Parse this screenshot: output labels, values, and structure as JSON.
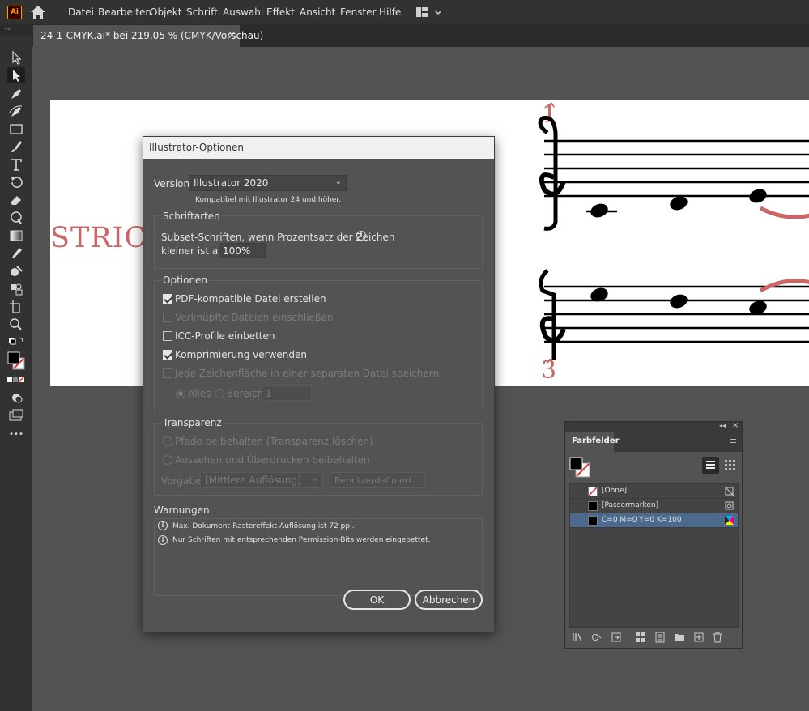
{
  "app": {
    "logo": "Ai"
  },
  "menu": [
    "Datei",
    "Bearbeiten",
    "Objekt",
    "Schrift",
    "Auswahl",
    "Effekt",
    "Ansicht",
    "Fenster",
    "Hilfe"
  ],
  "document_tab": {
    "title": "24-1-CMYK.ai* bei 219,05 % (CMYK/Vorschau)",
    "close": "×"
  },
  "toolbar": {
    "collapse": "››",
    "more": "•••",
    "tools": [
      "selection-tool",
      "direct-selection-tool",
      "pen-tool",
      "curvature-tool",
      "rectangle-tool",
      "paintbrush-tool",
      "type-tool",
      "rotate-tool",
      "eraser-tool",
      "warp-tool",
      "gradient-tool",
      "eyedropper-tool",
      "shape-builder-tool",
      "perspective-tool",
      "artboard-tool",
      "zoom-tool"
    ]
  },
  "artboard": {
    "strict_text": "STRICT",
    "score_top_label": "1̂",
    "score_bottom_label": "3̂"
  },
  "dialog": {
    "title": "Illustrator-Optionen",
    "version_label": "Version:",
    "version_value": "Illustrator 2020",
    "version_note": "Kompatibel mit Illustrator 24 und höher.",
    "fonts_group": "Schriftarten",
    "subset_label_1": "Subset-Schriften, wenn Prozentsatz der Zeichen",
    "subset_label_2": "kleiner ist als:",
    "subset_value": "100%",
    "options_group": "Optionen",
    "options": [
      {
        "label": "PDF-kompatible Datei erstellen",
        "checked": true,
        "disabled": false
      },
      {
        "label": "Verknüpfte Dateien einschließen",
        "checked": false,
        "disabled": true
      },
      {
        "label": "ICC-Profile einbetten",
        "checked": false,
        "disabled": false
      },
      {
        "label": "Komprimierung verwenden",
        "checked": true,
        "disabled": false
      },
      {
        "label": "Jede Zeichenfläche in einer separaten Datei speichern",
        "checked": false,
        "disabled": true
      }
    ],
    "radio_all": "Alles",
    "radio_range": "Bereich:",
    "range_value": "1",
    "transparency_group": "Transparenz",
    "transparency_options": [
      "Pfade beibehalten (Transparenz löschen)",
      "Aussehen und Überdrucken beibehalten"
    ],
    "preset_label": "Vorgabe:",
    "preset_value": "[Mittlere Auflösung]",
    "custom_button": "Benutzerdefiniert...",
    "warnings_label": "Warnungen",
    "warnings": [
      "Max. Dokument-Rastereffekt-Auflösung ist 72 ppi.",
      "Nur Schriften mit entsprechenden Permission-Bits werden eingebettet."
    ],
    "ok": "OK",
    "cancel": "Abbrechen"
  },
  "swatches": {
    "title": "Farbfelder",
    "items": [
      {
        "name": "[Ohne]",
        "type": "none"
      },
      {
        "name": "[Passermarken]",
        "type": "registration"
      },
      {
        "name": "C=0 M=0 Y=0 K=100",
        "type": "process",
        "selected": true
      }
    ]
  }
}
